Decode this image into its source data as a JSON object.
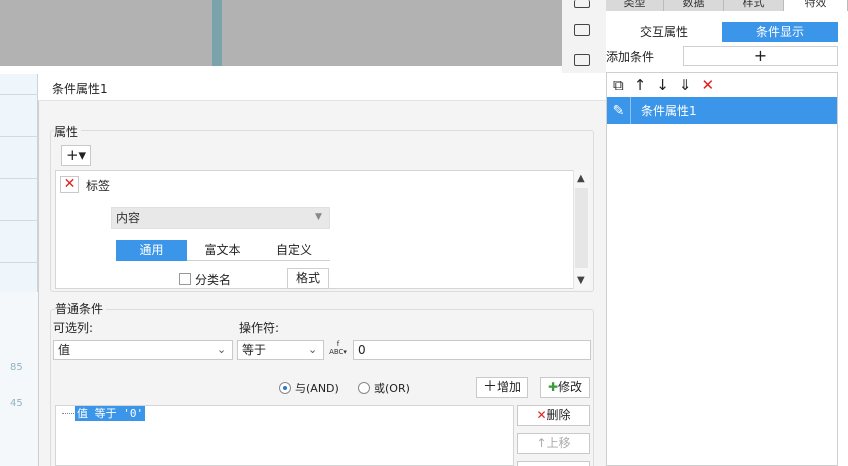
{
  "colors": {
    "accent": "#3b95e9",
    "delete_red": "#e02020",
    "dialog_bg": "#f4f4f4"
  },
  "top_tabs": [
    "类型",
    "数据",
    "样式",
    "特效"
  ],
  "right_panel": {
    "subtabs": [
      {
        "label": "交互属性",
        "active": false
      },
      {
        "label": "条件显示",
        "active": true
      }
    ],
    "add_condition_label": "添加条件",
    "add_condition_button": "+",
    "toolbar_icons": [
      "copy-icon",
      "arrow-up-icon",
      "arrow-down-icon",
      "move-bottom-icon",
      "delete-icon"
    ],
    "conditions": [
      {
        "label": "条件属性1",
        "selected": true
      }
    ]
  },
  "background": {
    "chart_ticks": [
      "85",
      "45"
    ]
  },
  "dialog": {
    "title": "条件属性1",
    "properties": {
      "legend": "属性",
      "add_button": "+▾",
      "items": [
        {
          "label": "标签"
        }
      ],
      "content_select": "内容",
      "format_tabs": [
        {
          "label": "通用",
          "active": true
        },
        {
          "label": "富文本",
          "active": false
        },
        {
          "label": "自定义",
          "active": false
        }
      ],
      "category_checkbox": {
        "label": "分类名",
        "checked": false
      },
      "format_button": "格式"
    },
    "normal_condition": {
      "legend": "普通条件",
      "column_label": "可选列:",
      "column_value": "值",
      "operator_label": "操作符:",
      "operator_value": "等于",
      "value_input": "0",
      "logic": [
        {
          "label": "与(AND)",
          "selected": true
        },
        {
          "label": "或(OR)",
          "selected": false
        }
      ],
      "add_button": "增加",
      "modify_button": "修改",
      "delete_button": "删除",
      "move_up_button": "上移",
      "expression": "值 等于 '0'"
    }
  }
}
